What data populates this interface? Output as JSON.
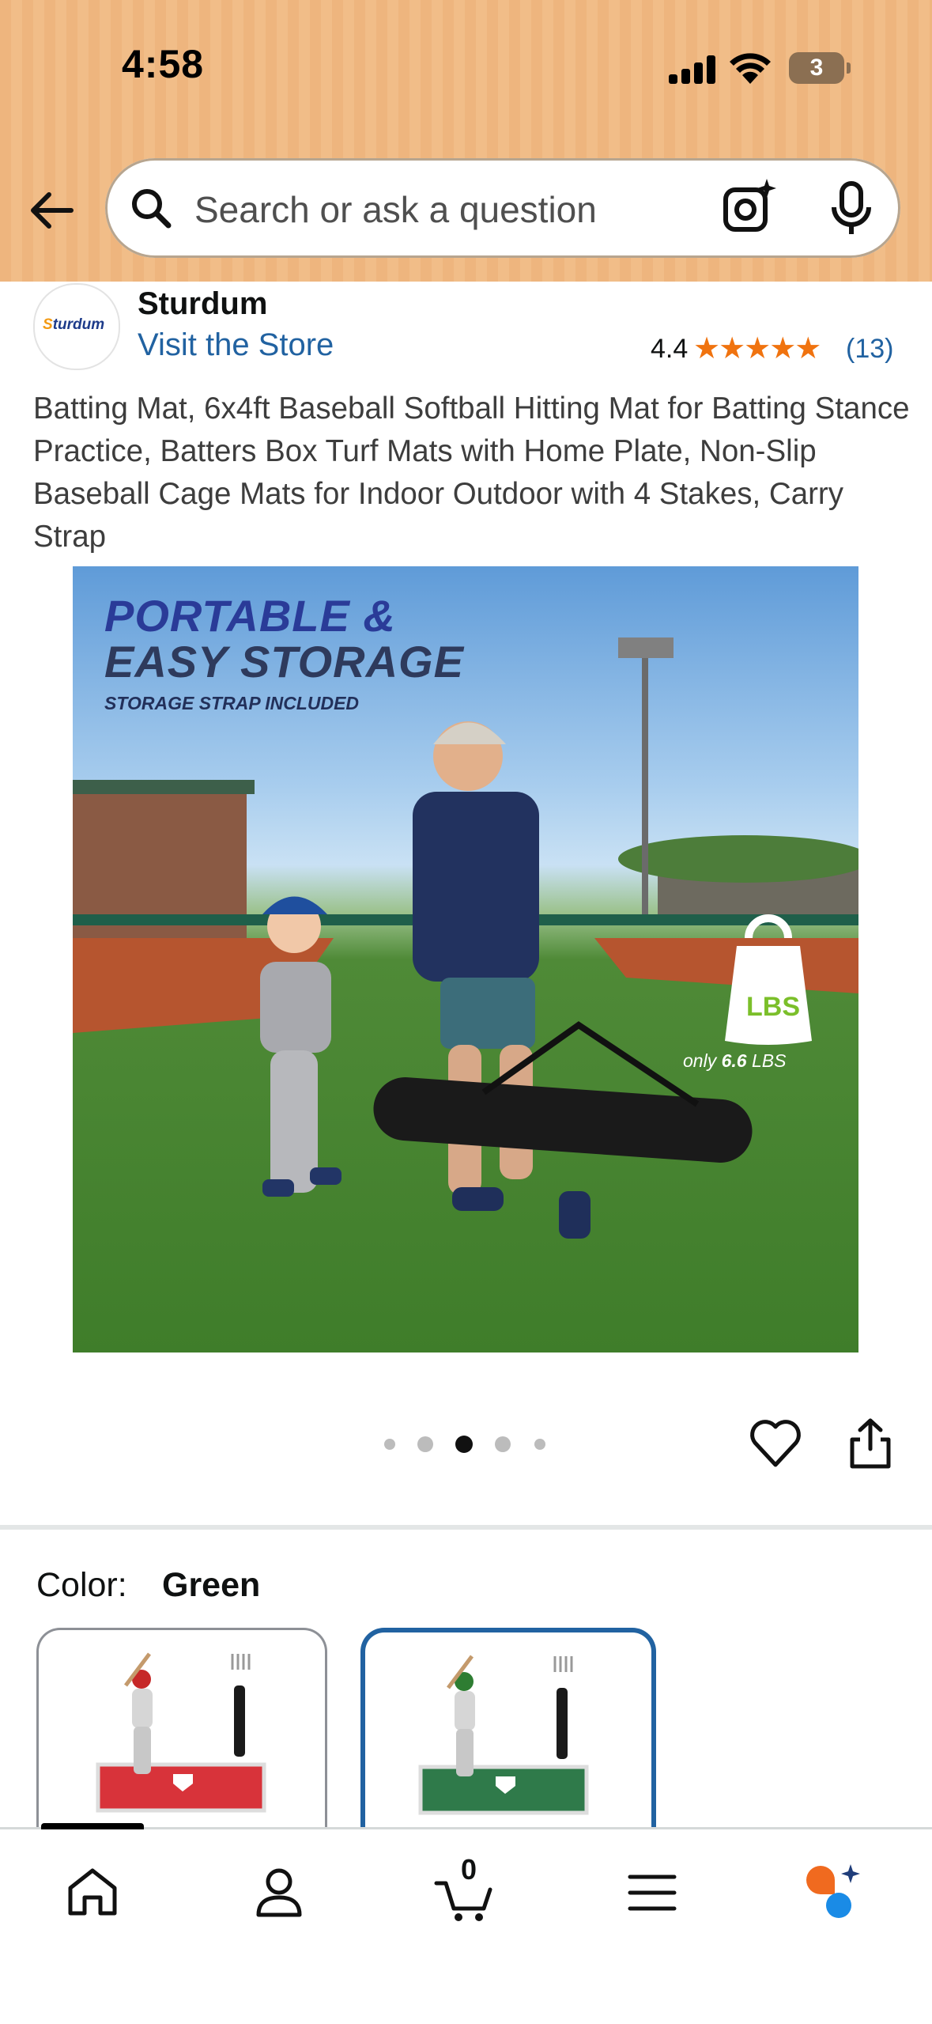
{
  "status_bar": {
    "time": "4:58",
    "battery": "3"
  },
  "header": {
    "search_placeholder": "Search or ask a question",
    "back_icon": "back-arrow-icon",
    "search_icon": "magnifier-icon",
    "camera_icon": "camera-sparkle-icon",
    "mic_icon": "microphone-icon"
  },
  "brand": {
    "logo_text_prefix": "S",
    "logo_text_rest": "turdum",
    "name": "Sturdum",
    "visit_store": "Visit the Store",
    "rating": "4.4",
    "stars": 4.4,
    "rating_count": "(13)"
  },
  "product": {
    "title": "Batting Mat, 6x4ft Baseball Softball Hitting Mat for Batting Stance Practice, Batters Box Turf Mats with Home Plate, Non-Slip Baseball Cage Mats for Indoor Outdoor with 4 Stakes, Carry Strap",
    "image": {
      "headline_line1": "PORTABLE &",
      "headline_line2": "EASY STORAGE",
      "subline": "STORAGE STRAP INCLUDED",
      "weight_icon_label": "LBS",
      "weight_text_prefix": "only ",
      "weight_text_value": "6.6",
      "weight_text_unit": " LBS"
    },
    "carousel": {
      "total": 5,
      "active_index": 2
    }
  },
  "color": {
    "label": "Color:",
    "value": "Green",
    "options": [
      {
        "name": "Red",
        "selected": false,
        "mat_color": "#d8333a"
      },
      {
        "name": "Green",
        "selected": true,
        "mat_color": "#2f7a4a"
      }
    ]
  },
  "bottom_nav": {
    "items": [
      "home-icon",
      "account-icon",
      "cart-icon",
      "menu-icon",
      "rufus-icon"
    ],
    "cart_count": "0",
    "active_index": 0
  },
  "colors": {
    "header_bg": "#f1bd88",
    "link": "#2162a1",
    "star": "#f0730f",
    "selected_border": "#2162a1"
  }
}
